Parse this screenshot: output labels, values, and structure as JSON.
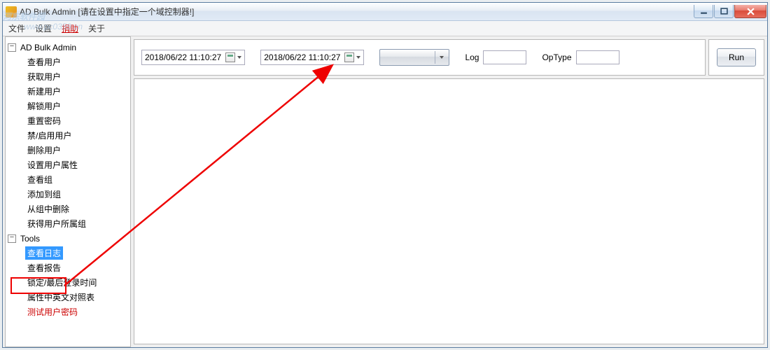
{
  "title": "AD Bulk Admin [请在设置中指定一个域控制器!]",
  "menu": {
    "file": "文件",
    "settings": "设置",
    "donate": "捐助",
    "about": "关于"
  },
  "tree": {
    "root1": "AD Bulk Admin",
    "items1": [
      "查看用户",
      "获取用户",
      "新建用户",
      "解锁用户",
      "重置密码",
      "禁/启用用户",
      "删除用户",
      "设置用户属性",
      "查看组",
      "添加到组",
      "从组中删除",
      "获得用户所属组"
    ],
    "root2": "Tools",
    "items2": [
      "查看日志",
      "查看报告",
      "锁定/最后登录时间",
      "属性中英文对照表",
      "测试用户密码"
    ]
  },
  "filters": {
    "date1": "2018/06/22 11:10:27",
    "date2": "2018/06/22 11:10:27",
    "log_label": "Log",
    "optype_label": "OpType",
    "log_value": "",
    "optype_value": ""
  },
  "run_label": "Run",
  "watermark": {
    "main": "河东软件园",
    "sub": "www.pc0359.cn"
  }
}
